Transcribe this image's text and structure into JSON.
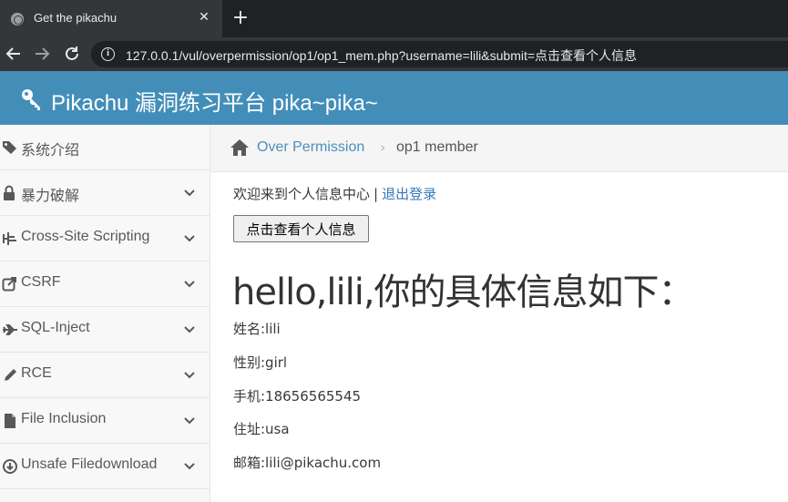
{
  "browser": {
    "tab_title": "Get the pikachu",
    "tab_close": "✕",
    "new_tab": "+",
    "url": "127.0.0.1/vul/overpermission/op1/op1_mem.php?username=lili&submit=点击查看个人信息"
  },
  "header": {
    "title": "Pikachu 漏洞练习平台 pika~pika~"
  },
  "sidebar": {
    "items": [
      {
        "label": "系统介绍",
        "icon": "tags-icon",
        "has_chevron": false
      },
      {
        "label": "暴力破解",
        "icon": "lock-icon",
        "has_chevron": true
      },
      {
        "label": "Cross-Site Scripting",
        "icon": "sitemap-icon",
        "has_chevron": true
      },
      {
        "label": "CSRF",
        "icon": "share-icon",
        "has_chevron": true
      },
      {
        "label": "SQL-Inject",
        "icon": "plane-icon",
        "has_chevron": true
      },
      {
        "label": "RCE",
        "icon": "pencil-icon",
        "has_chevron": true
      },
      {
        "label": "File Inclusion",
        "icon": "file-icon",
        "has_chevron": true
      },
      {
        "label": "Unsafe Filedownload",
        "icon": "download-icon",
        "has_chevron": true
      }
    ]
  },
  "breadcrumb": {
    "link": "Over Permission",
    "separator": "›",
    "current": "op1 member"
  },
  "main": {
    "welcome_text": "欢迎来到个人信息中心",
    "divider": "|",
    "logout": "退出登录",
    "button_label": "点击查看个人信息",
    "hello": "hello,lili,你的具体信息如下：",
    "info": [
      "姓名:lili",
      "性别:girl",
      "手机:18656565545",
      "住址:usa",
      "邮箱:lili@pikachu.com"
    ]
  },
  "colors": {
    "header_bg": "#438eb9",
    "link": "#337ab7"
  }
}
